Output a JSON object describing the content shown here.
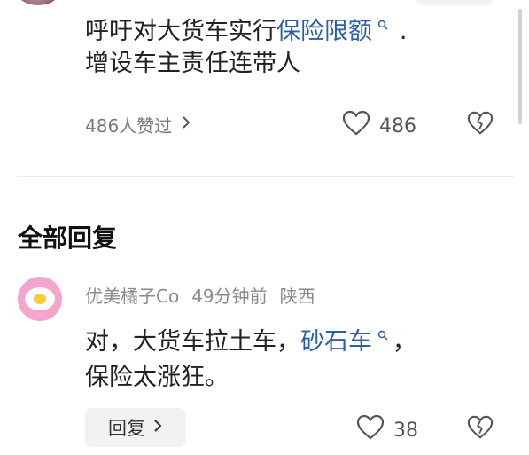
{
  "post": {
    "text_line1_prefix": "呼吁对大货车实行",
    "text_line1_link": "保险限额",
    "text_line1_suffix": ".",
    "text_line2": "增设车主责任连带人",
    "liked_by": "486人赞过",
    "like_count": "486"
  },
  "comments": {
    "section_title": "全部回复",
    "items": [
      {
        "username": "优美橘子Co",
        "time": "49分钟前",
        "location": "陕西",
        "text_line1_prefix": "对，大货车拉土车，",
        "text_line1_link": "砂石车",
        "text_line1_suffix": "，",
        "text_line2": "保险太涨狂。",
        "reply_label": "回复",
        "like_count": "38"
      }
    ]
  },
  "icons": {
    "like": "heart-outline-icon",
    "dislike": "broken-heart-icon",
    "search_hint": "search-icon",
    "more": "chevron-right-icon"
  },
  "colors": {
    "link": "#2b5fa8",
    "avatar_bg": "#f3a5cc"
  }
}
